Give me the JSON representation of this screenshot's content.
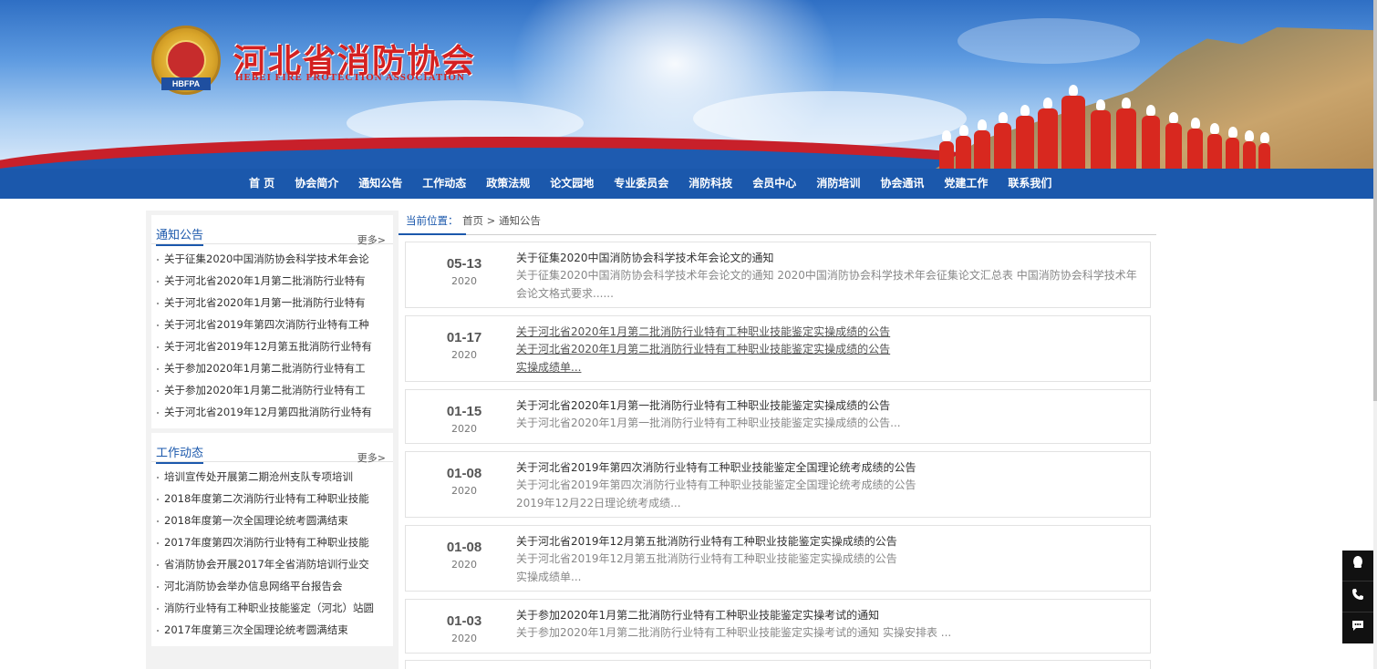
{
  "header": {
    "title_cn": "河北省消防协会",
    "title_en": "HEBEI FIRE PROTECTION ASSOCIATION",
    "emblem_text": "HBFPA"
  },
  "nav": {
    "items": [
      "首 页",
      "协会简介",
      "通知公告",
      "工作动态",
      "政策法规",
      "论文园地",
      "专业委员会",
      "消防科技",
      "会员中心",
      "消防培训",
      "协会通讯",
      "党建工作",
      "联系我们"
    ]
  },
  "sidebar": {
    "notice": {
      "title": "通知公告",
      "more": "更多>",
      "items": [
        "关于征集2020中国消防协会科学技术年会论",
        "关于河北省2020年1月第二批消防行业特有",
        "关于河北省2020年1月第一批消防行业特有",
        "关于河北省2019年第四次消防行业特有工种",
        "关于河北省2019年12月第五批消防行业特有",
        "关于参加2020年1月第二批消防行业特有工",
        "关于参加2020年1月第二批消防行业特有工",
        "关于河北省2019年12月第四批消防行业特有"
      ]
    },
    "work": {
      "title": "工作动态",
      "more": "更多>",
      "items": [
        "培训宣传处开展第二期沧州支队专项培训",
        "2018年度第二次消防行业特有工种职业技能",
        "2018年度第一次全国理论统考圆满结束",
        "2017年度第四次消防行业特有工种职业技能",
        "省消防协会开展2017年全省消防培训行业交",
        "河北消防协会举办信息网络平台报告会",
        "消防行业特有工种职业技能鉴定（河北）站圆",
        "2017年度第三次全国理论统考圆满结束"
      ]
    }
  },
  "breadcrumb": {
    "label": "当前位置：",
    "path": "首页 > 通知公告"
  },
  "list": [
    {
      "md": "05-13",
      "yr": "2020",
      "title": "关于征集2020中国消防协会科学技术年会论文的通知",
      "desc": "关于征集2020中国消防协会科学技术年会论文的通知 2020中国消防协会科学技术年会征集论文汇总表 中国消防协会科学技术年会论文格式要求......"
    },
    {
      "md": "01-17",
      "yr": "2020",
      "title": "关于河北省2020年1月第二批消防行业特有工种职业技能鉴定实操成绩的公告",
      "desc": "关于河北省2020年1月第二批消防行业特有工种职业技能鉴定实操成绩的公告 实操成绩单..."
    },
    {
      "md": "01-15",
      "yr": "2020",
      "title": "关于河北省2020年1月第一批消防行业特有工种职业技能鉴定实操成绩的公告",
      "desc": "关于河北省2020年1月第一批消防行业特有工种职业技能鉴定实操成绩的公告..."
    },
    {
      "md": "01-08",
      "yr": "2020",
      "title": "关于河北省2019年第四次消防行业特有工种职业技能鉴定全国理论统考成绩的公告",
      "desc": "关于河北省2019年第四次消防行业特有工种职业技能鉴定全国理论统考成绩的公告 2019年12月22日理论统考成绩..."
    },
    {
      "md": "01-08",
      "yr": "2020",
      "title": "关于河北省2019年12月第五批消防行业特有工种职业技能鉴定实操成绩的公告",
      "desc": "关于河北省2019年12月第五批消防行业特有工种职业技能鉴定实操成绩的公告 实操成绩单..."
    },
    {
      "md": "01-03",
      "yr": "2020",
      "title": "关于参加2020年1月第二批消防行业特有工种职业技能鉴定实操考试的通知",
      "desc": "关于参加2020年1月第二批消防行业特有工种职业技能鉴定实操考试的通知 实操安排表 ..."
    }
  ],
  "float_widget": {
    "icons": [
      "qq-icon",
      "phone-icon",
      "chat-icon"
    ]
  }
}
